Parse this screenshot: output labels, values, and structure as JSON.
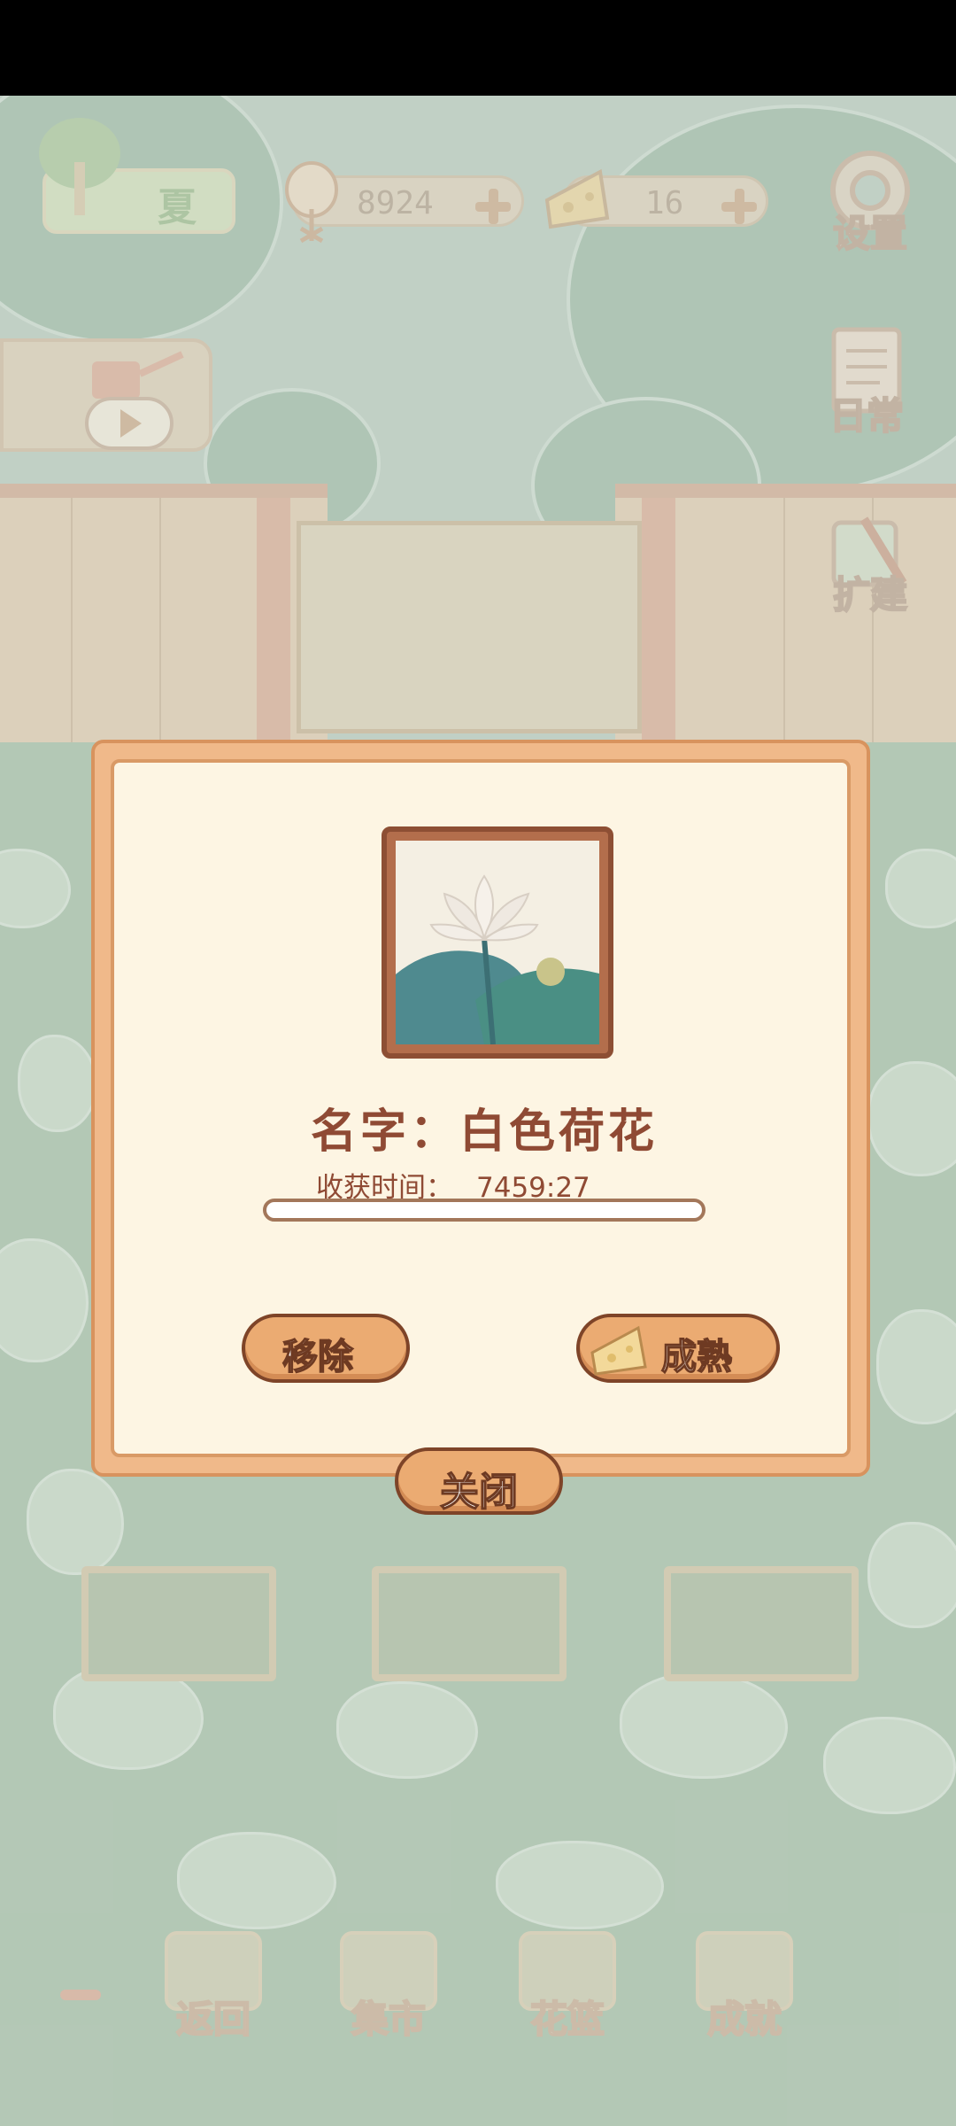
{
  "hud": {
    "season": "夏",
    "fish_count": "8924",
    "cheese_count": "16"
  },
  "side_menu": {
    "settings": "设置",
    "daily": "日常",
    "expand": "扩建"
  },
  "dialog": {
    "plant_name": "名字：白色荷花",
    "harvest_label": "收获时间：",
    "harvest_time": "7459:27",
    "progress": 0.0,
    "remove_label": "移除",
    "mature_label": "成熟",
    "close_label": "关闭"
  },
  "bottom_nav": {
    "back": "返回",
    "market": "集市",
    "flower_basket": "花篮",
    "achievement": "成就"
  },
  "icons": [
    "tree-icon",
    "fish-bone-icon",
    "cheese-icon",
    "plus-icon",
    "gear-icon",
    "notebook-icon",
    "tools-icon",
    "watering-can-icon",
    "play-icon",
    "lotus-icon",
    "minus-icon",
    "window-icon",
    "market-stall-icon",
    "flower-basket-icon",
    "trophy-icon"
  ]
}
